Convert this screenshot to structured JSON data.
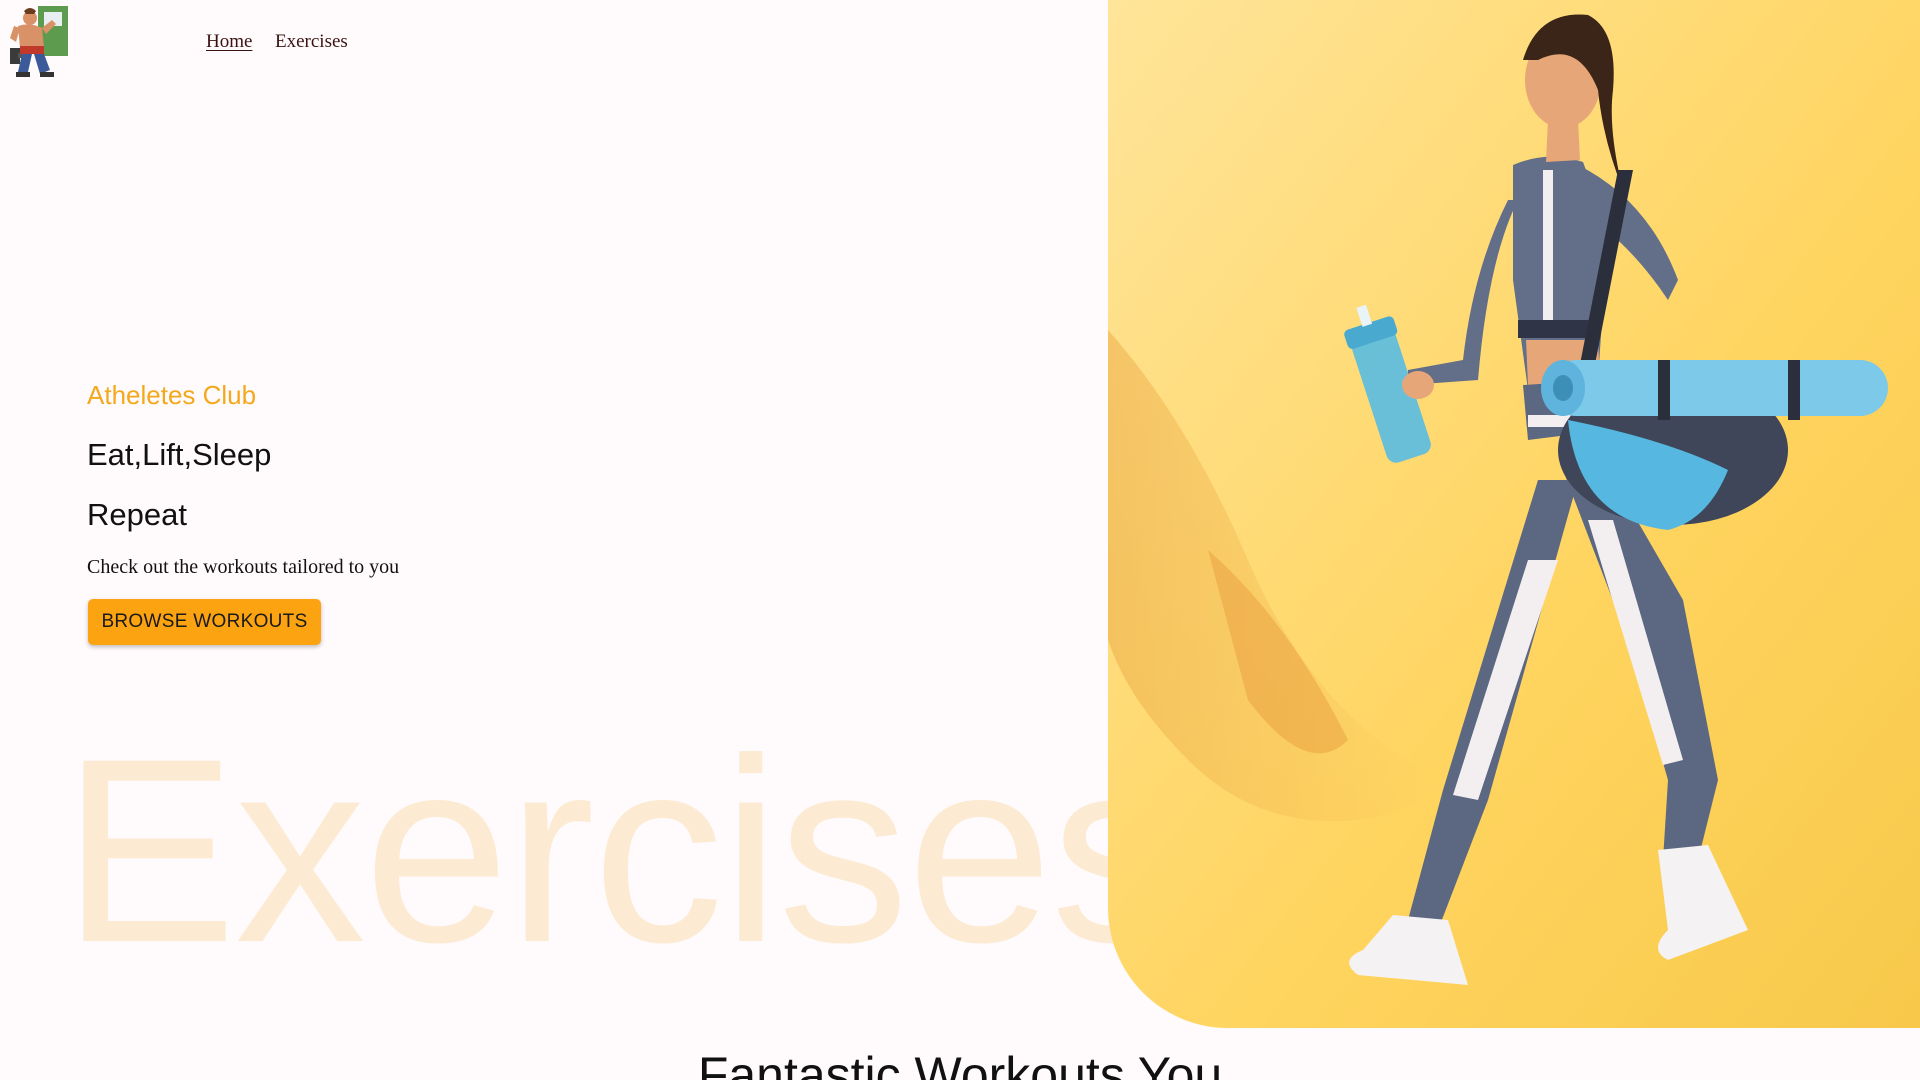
{
  "nav": {
    "logo_icon": "bodybuilder-logo-icon",
    "links": [
      {
        "label": "Home",
        "active": true
      },
      {
        "label": "Exercises",
        "active": false
      }
    ]
  },
  "hero": {
    "tagline": "Atheletes Club",
    "headline_line1": "Eat,Lift,Sleep",
    "headline_line2": "Repeat",
    "description": "Check out the workouts tailored to you",
    "cta_label": "BROWSE WORKOUTS",
    "watermark_text": "Exercises",
    "image_subject": "woman-walking-with-gym-bag-photo"
  },
  "section": {
    "heading": "Fantastic Workouts You"
  },
  "colors": {
    "accent": "#fca311",
    "tagline": "#f4a81d",
    "background": "#fffafb",
    "watermark": "#fcebd2",
    "hero_bg": "#ffd966"
  }
}
